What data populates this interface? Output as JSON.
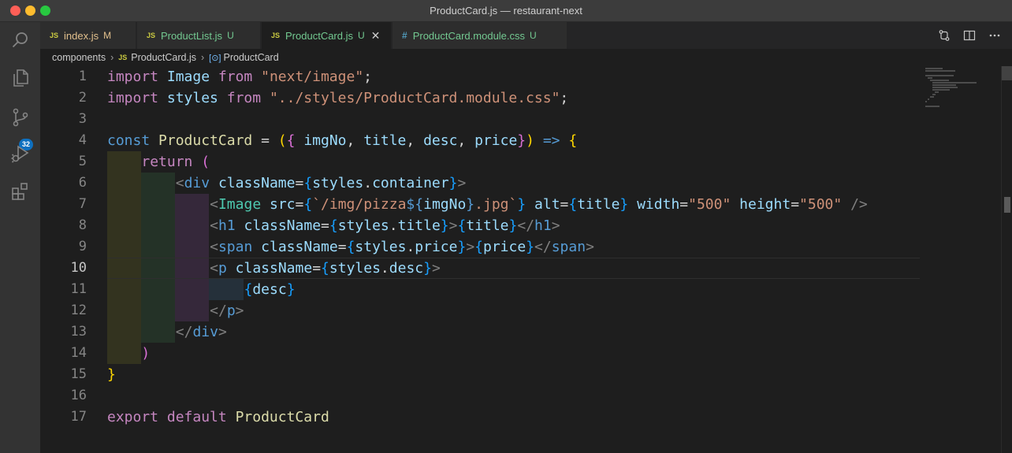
{
  "window": {
    "title": "ProductCard.js — restaurant-next"
  },
  "activity_bar": {
    "items": [
      {
        "icon": "search-icon"
      },
      {
        "icon": "files-icon"
      },
      {
        "icon": "source-control-icon",
        "badge": "32"
      },
      {
        "icon": "run-debug-icon"
      },
      {
        "icon": "extensions-icon"
      }
    ]
  },
  "tabs": [
    {
      "icon": "JS",
      "label": "index.js",
      "status": "M"
    },
    {
      "icon": "JS",
      "label": "ProductList.js",
      "status": "U"
    },
    {
      "icon": "JS",
      "label": "ProductCard.js",
      "status": "U",
      "close": "✕"
    },
    {
      "icon": "#",
      "label": "ProductCard.module.css",
      "status": "U"
    }
  ],
  "breadcrumb": {
    "folder": "components",
    "file_icon": "JS",
    "file": "ProductCard.js",
    "symbol": "ProductCard"
  },
  "editor": {
    "current_line": "10",
    "line_numbers": [
      "1",
      "2",
      "3",
      "4",
      "5",
      "6",
      "7",
      "8",
      "9",
      "10",
      "11",
      "12",
      "13",
      "14",
      "15",
      "16",
      "17"
    ],
    "lines": [
      "import Image from \"next/image\";",
      "import styles from \"../styles/ProductCard.module.css\";",
      "",
      "const ProductCard = ({ imgNo, title, desc, price}) => {",
      "    return (",
      "        <div className={styles.container}>",
      "            <Image src={`/img/pizza${imgNo}.jpg`} alt={title} width=\"500\" height=\"500\" />",
      "            <h1 className={styles.title}>{title}</h1>",
      "            <span className={styles.price}>{price}</span>",
      "            <p className={styles.desc}>",
      "                {desc}",
      "            </p>",
      "        </div>",
      "    )",
      "}",
      "",
      "export default ProductCard"
    ]
  },
  "colors": {
    "keyword": "#c586c0",
    "declaration": "#569cd6",
    "variable": "#9cdcfe",
    "type": "#4ec9b0",
    "function": "#dcdcaa",
    "string": "#ce9178",
    "badge": "#0e70c0"
  }
}
